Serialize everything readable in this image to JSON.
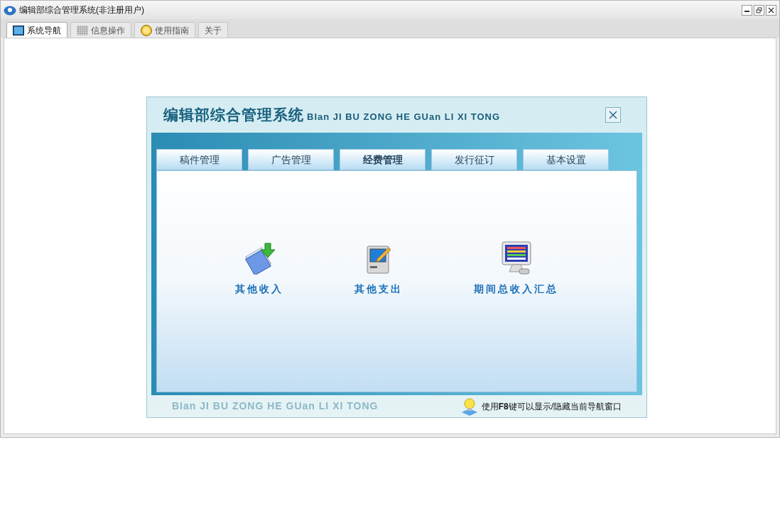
{
  "window": {
    "title": "编辑部综合管理系统(非注册用户)"
  },
  "tabs": [
    {
      "label": "系统导航",
      "selected": true,
      "kind": "monitor"
    },
    {
      "label": "信息操作",
      "selected": false,
      "kind": "grid"
    },
    {
      "label": "使用指南",
      "selected": false,
      "kind": "help"
    },
    {
      "label": "关于",
      "selected": false,
      "kind": "plain"
    }
  ],
  "dialog": {
    "title": "编辑部综合管理系统",
    "subtitle": "BIan JI BU ZONG HE GUan LI XI TONG",
    "tabs": [
      {
        "label": "稿件管理",
        "selected": false
      },
      {
        "label": "广告管理",
        "selected": false
      },
      {
        "label": "经费管理",
        "selected": true
      },
      {
        "label": "发行征订",
        "selected": false
      },
      {
        "label": "基本设置",
        "selected": false
      }
    ],
    "items": [
      {
        "label": "其他收入",
        "kind": "income"
      },
      {
        "label": "其他支出",
        "kind": "expense"
      },
      {
        "label": "期间总收入汇总",
        "kind": "summary"
      }
    ],
    "footer_brand": "BIan JI BU ZONG HE GUan LI XI TONG",
    "hint": "使用**F8**键可以显示/隐藏当前导航窗口"
  }
}
